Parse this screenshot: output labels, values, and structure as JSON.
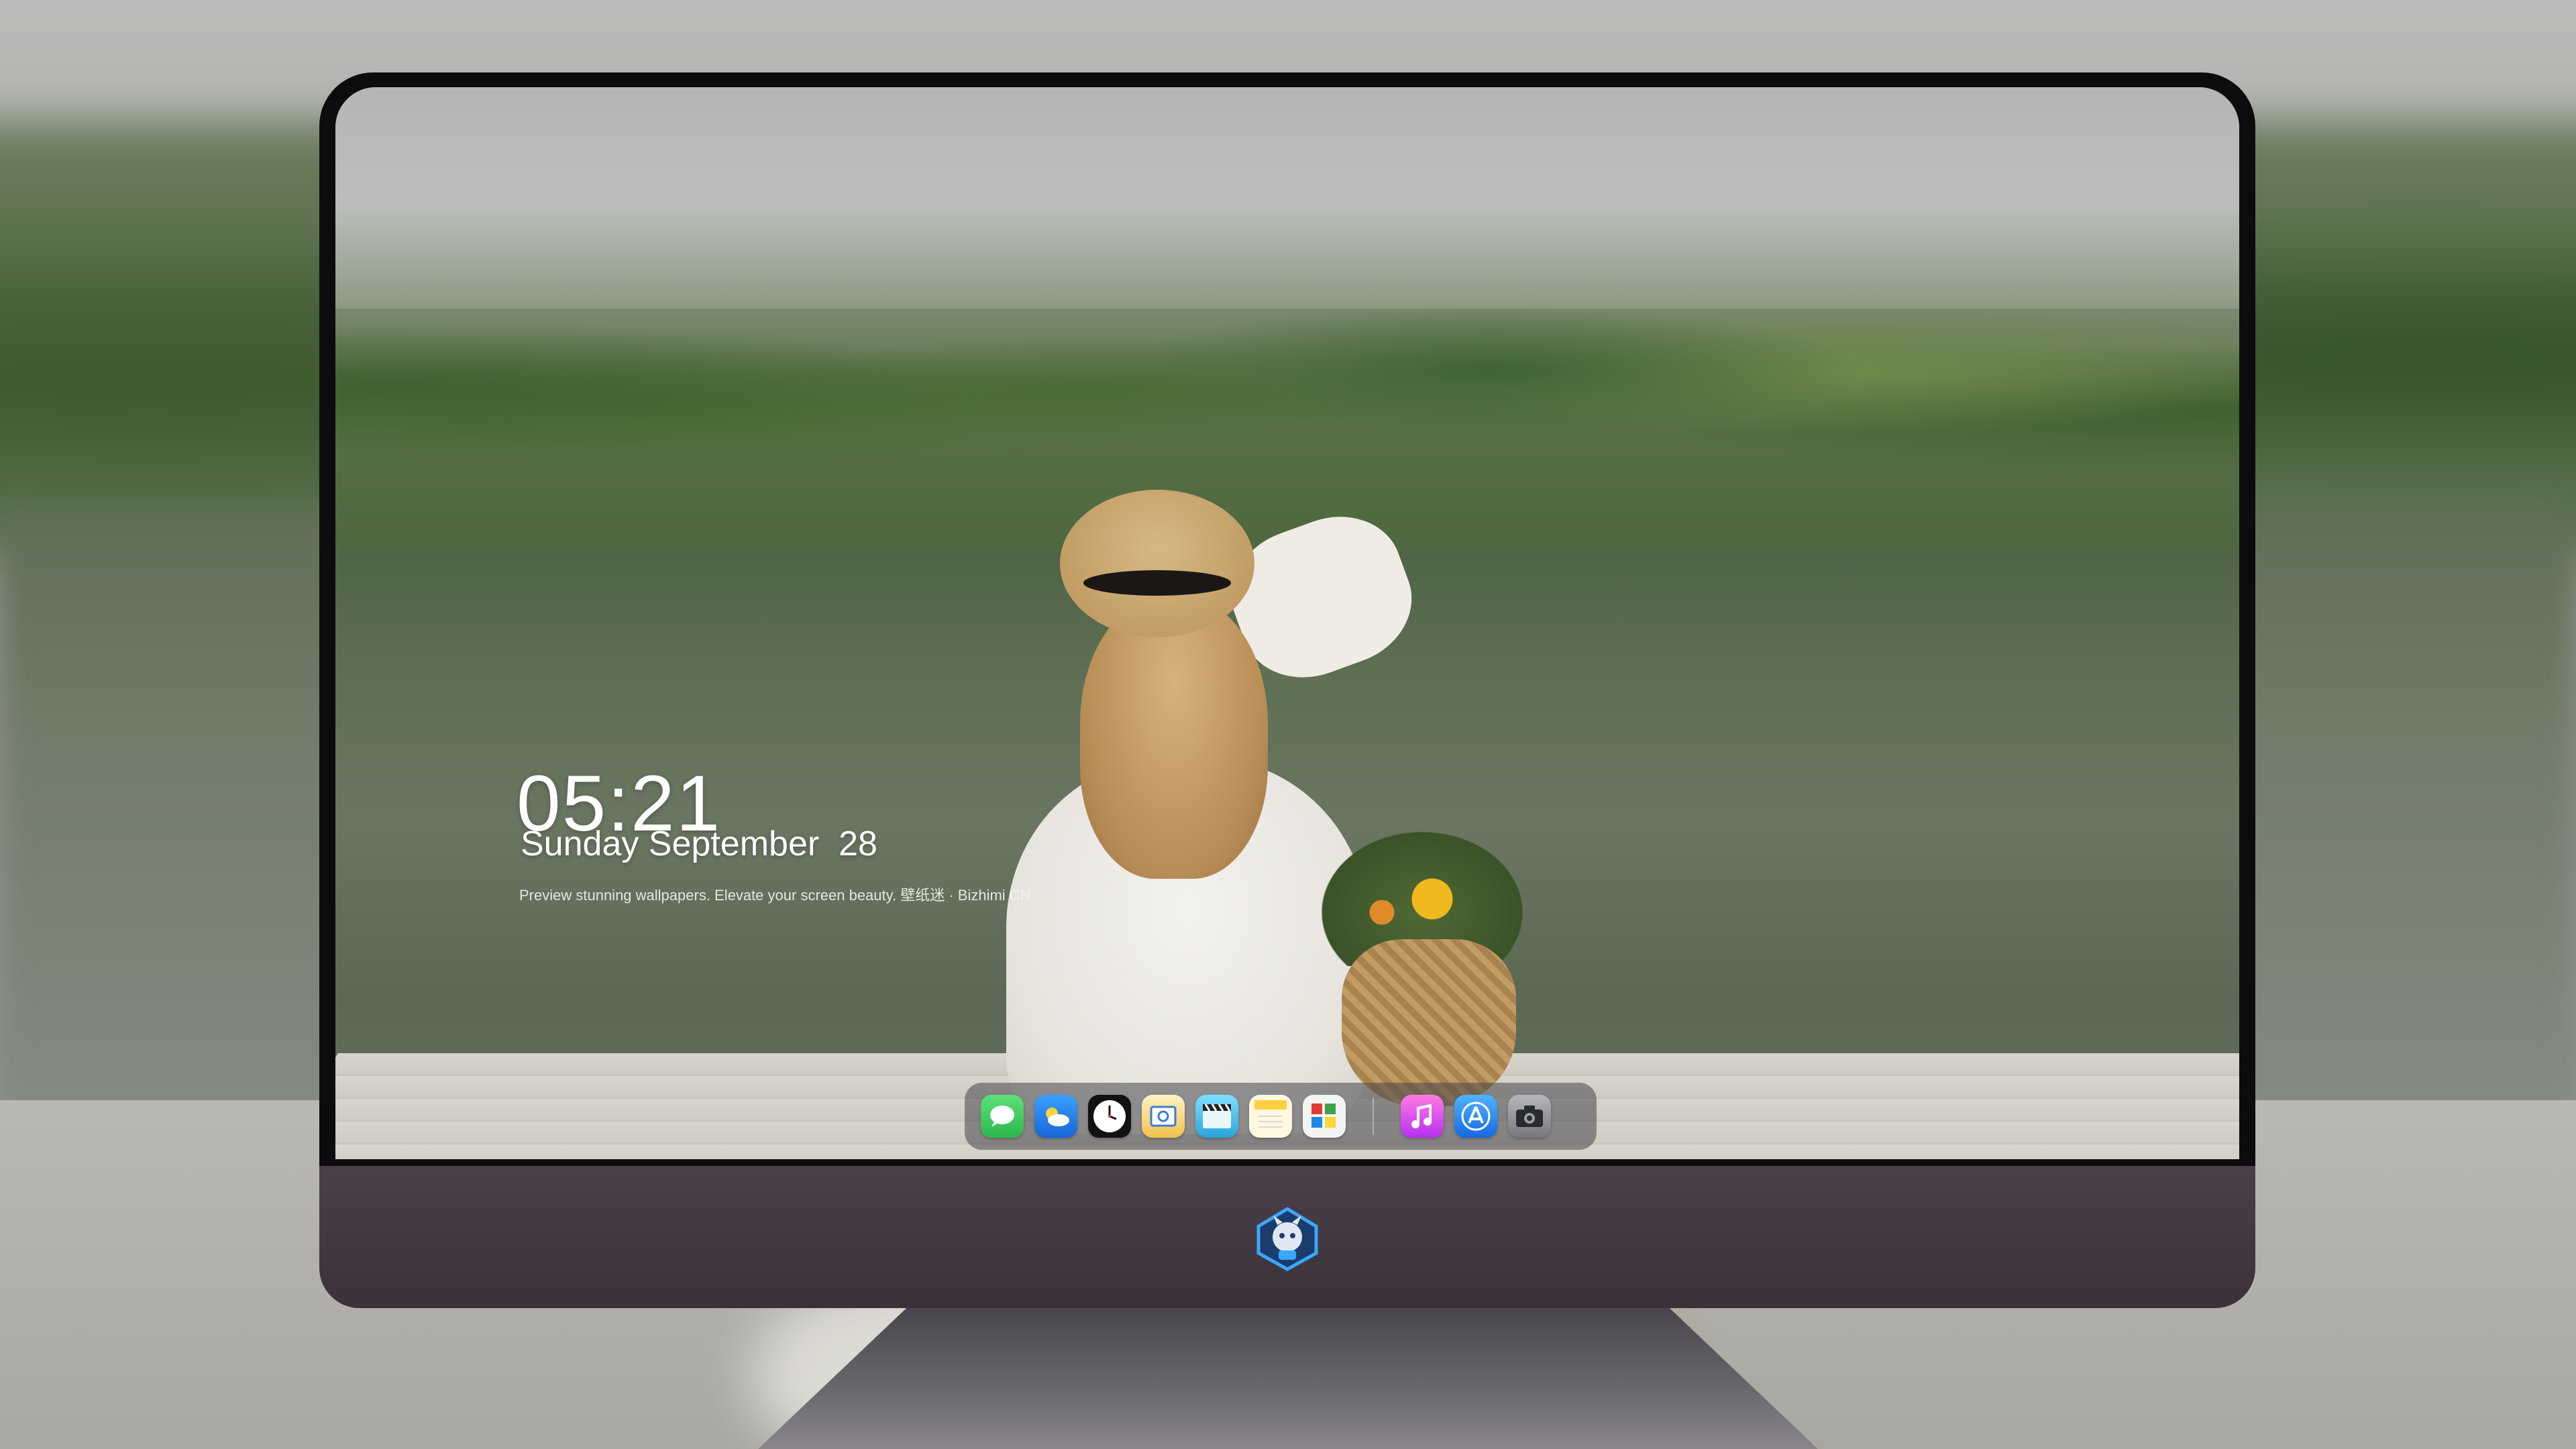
{
  "lock_screen": {
    "time": "05:21",
    "date": "Sunday September  28",
    "caption": "Preview stunning wallpapers. Elevate your screen beauty. 壁纸迷 · Bizhimi CN"
  },
  "dock": {
    "apps": [
      {
        "name": "messages-icon",
        "color": "#34c759"
      },
      {
        "name": "weather-icon",
        "color": "#1e88e5"
      },
      {
        "name": "clock-icon",
        "color": "#111111"
      },
      {
        "name": "preview-icon",
        "color": "#f5c542"
      },
      {
        "name": "video-icon",
        "color": "#3ab0e0"
      },
      {
        "name": "notes-icon",
        "color": "#ffd54f"
      },
      {
        "name": "photos-icon",
        "color": "#f0f0f0"
      },
      {
        "name": "music-icon",
        "color": "#e040fb"
      },
      {
        "name": "app-store-icon",
        "color": "#1e88e5"
      },
      {
        "name": "camera-icon",
        "color": "#8e8e93"
      }
    ]
  }
}
